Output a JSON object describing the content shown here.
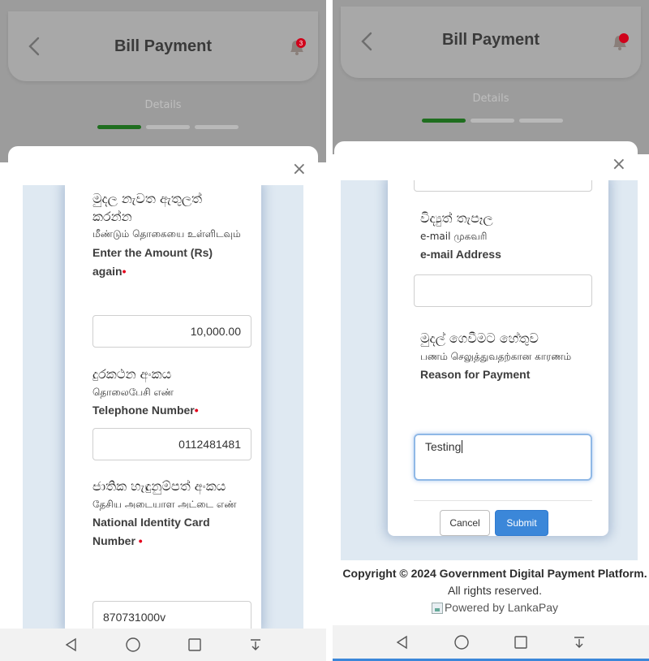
{
  "header": {
    "title": "Bill Payment",
    "step_label": "Details",
    "notification_count": "3"
  },
  "form": {
    "amount_again": {
      "label_si": "මුදල නැවත ඇතුලත් කරන්න",
      "label_ta": "மீண்டும் தொகையை உள்ளிடவும்",
      "label_en": "Enter the Amount (Rs) again",
      "required_mark": "•",
      "value": "10,000.00"
    },
    "telephone": {
      "label_si": "දුරකථන අංකය",
      "label_ta": "தொலைபேசி எண்",
      "label_en": "Telephone Number",
      "required_mark": "•",
      "value": "0112481481"
    },
    "nic": {
      "label_si": "ජාතික හැඳුනුම්පත් අංකය",
      "label_ta": "தேசிய அடையாள அட்டை எண்",
      "label_en": "National Identity Card Number",
      "required_mark": "•",
      "value": "870731000v"
    },
    "email": {
      "label_si": "විද්‍යුත් තැපෑල",
      "label_ta": "e-mail முகவரி",
      "label_en": "e-mail Address",
      "value": ""
    },
    "reason": {
      "label_si": "මුදල් ගෙවීමට හේතුව",
      "label_ta": "பணம் செலுத்துவதற்கான காரணம்",
      "label_en": "Reason for Payment",
      "value": "Testing"
    }
  },
  "buttons": {
    "cancel": "Cancel",
    "submit": "Submit",
    "close": "×"
  },
  "footer": {
    "copyright_bold": "Copyright © 2024 Government Digital Payment Platform.",
    "rights": "All rights reserved.",
    "powered_alt": "Powered by LankaPay"
  },
  "colors": {
    "accent_green": "#1f6e1f",
    "submit_blue": "#3b87d9",
    "required_red": "#e4001b",
    "badge_red": "#d0021b"
  }
}
